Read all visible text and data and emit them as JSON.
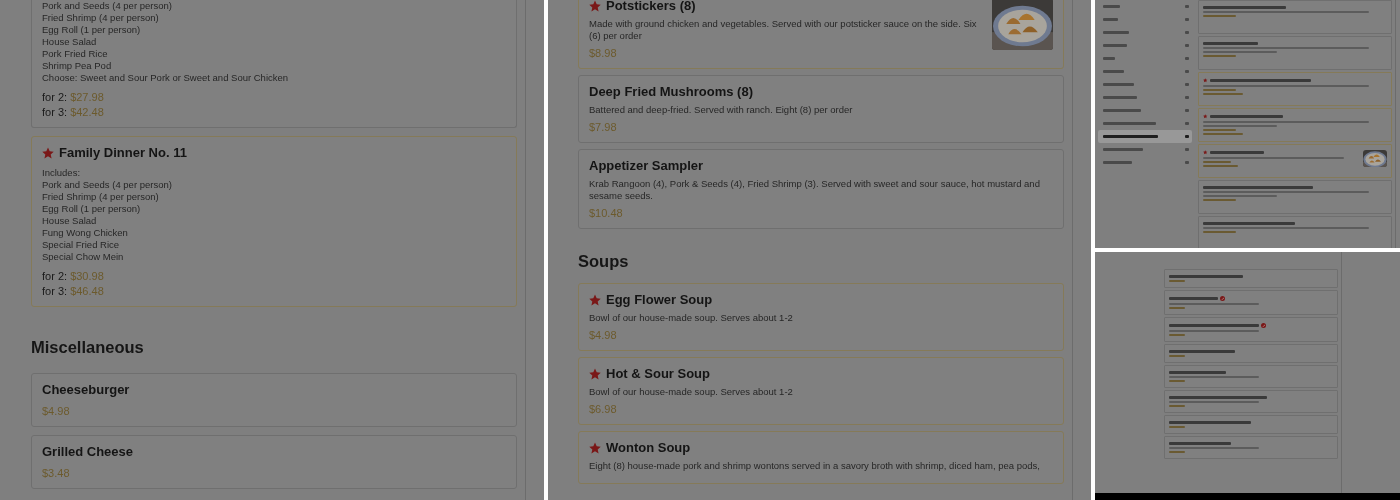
{
  "panels": [
    {
      "kind": "large",
      "items": [
        {
          "kind": "card",
          "starred": false,
          "lines": [
            "Pork and Seeds (4 per person)",
            "Fried Shrimp (4 per person)",
            "Egg Roll (1 per person)",
            "House Salad",
            "Pork Fried Rice",
            "Shrimp Pea Pod",
            "Choose: Sweet and Sour Pork or Sweet and Sour Chicken"
          ],
          "prices": [
            {
              "label": "for 2:",
              "amount": "$27.98"
            },
            {
              "label": "for 3:",
              "amount": "$42.48"
            }
          ]
        },
        {
          "kind": "card",
          "starred": true,
          "title": "Family Dinner No. 11",
          "lines": [
            "Includes:",
            "Pork and Seeds (4 per person)",
            "Fried Shrimp (4 per person)",
            "Egg Roll (1 per person)",
            "House Salad",
            "Fung Wong Chicken",
            "Special Fried Rice",
            "Special Chow Mein"
          ],
          "prices": [
            {
              "label": "for 2:",
              "amount": "$30.98"
            },
            {
              "label": "for 3:",
              "amount": "$46.48"
            }
          ]
        },
        {
          "kind": "heading",
          "text": "Miscellaneous"
        },
        {
          "kind": "card",
          "starred": false,
          "title": "Cheeseburger",
          "prices": [
            {
              "amount": "$4.98"
            }
          ]
        },
        {
          "kind": "card",
          "starred": false,
          "title": "Grilled Cheese",
          "prices": [
            {
              "amount": "$3.48"
            }
          ]
        }
      ]
    },
    {
      "kind": "large",
      "items": [
        {
          "kind": "card",
          "starred": true,
          "title": "Potstickers (8)",
          "description": "Made with ground chicken and vegetables. Served with our potsticker sauce on the side. Six (6) per order",
          "prices": [
            {
              "amount": "$8.98"
            }
          ],
          "image": {
            "kind": "picture"
          }
        },
        {
          "kind": "card",
          "starred": false,
          "title": "Deep Fried Mushrooms (8)",
          "description": "Battered and deep-fried. Served with ranch. Eight (8) per order",
          "prices": [
            {
              "amount": "$7.98"
            }
          ]
        },
        {
          "kind": "card",
          "starred": false,
          "title": "Appetizer Sampler",
          "description": "Krab Rangoon (4), Pork & Seeds (4), Fried Shrimp (3). Served with sweet and sour sauce, hot mustard and sesame seeds.",
          "prices": [
            {
              "amount": "$10.48"
            }
          ]
        },
        {
          "kind": "heading",
          "text": "Soups"
        },
        {
          "kind": "card",
          "starred": true,
          "title": "Egg Flower Soup",
          "description": "Bowl of our house-made soup. Serves about 1-2",
          "prices": [
            {
              "amount": "$4.98"
            }
          ]
        },
        {
          "kind": "card",
          "starred": true,
          "title": "Hot & Sour Soup",
          "description": "Bowl of our house-made soup. Serves about 1-2",
          "prices": [
            {
              "amount": "$6.98"
            }
          ]
        },
        {
          "kind": "card",
          "starred": true,
          "title": "Wonton Soup",
          "description": "Eight (8) house-made pork and shrimp wontons served in a savory broth with shrimp, diced ham, pea pods,"
        }
      ]
    },
    {
      "kind": "small",
      "sidebar": [
        {
          "selected": false
        },
        {
          "selected": false
        },
        {
          "selected": false
        },
        {
          "selected": false
        },
        {
          "selected": false
        },
        {
          "selected": false
        },
        {
          "selected": false
        },
        {
          "selected": false
        },
        {
          "selected": false
        },
        {
          "selected": false
        },
        {
          "selected": true
        },
        {
          "selected": false
        },
        {
          "selected": false
        }
      ],
      "items": [
        {
          "kind": "thumb",
          "starred": false
        },
        {
          "kind": "thumb",
          "starred": false
        },
        {
          "kind": "thumb",
          "starred": true
        },
        {
          "kind": "thumb",
          "starred": true
        },
        {
          "kind": "thumb",
          "starred": true,
          "image": {
            "kind": "picture"
          }
        },
        {
          "kind": "thumb",
          "starred": false
        },
        {
          "kind": "thumb",
          "starred": false
        }
      ]
    },
    {
      "kind": "mini",
      "items": [
        {
          "kind": "thumb",
          "spicy": false
        },
        {
          "kind": "thumb",
          "spicy": true
        },
        {
          "kind": "thumb",
          "spicy": true
        },
        {
          "kind": "thumb",
          "spicy": false
        },
        {
          "kind": "thumb",
          "spicy": false
        },
        {
          "kind": "thumb",
          "spicy": false
        },
        {
          "kind": "thumb",
          "spicy": false
        },
        {
          "kind": "thumb",
          "spicy": false
        }
      ]
    }
  ]
}
